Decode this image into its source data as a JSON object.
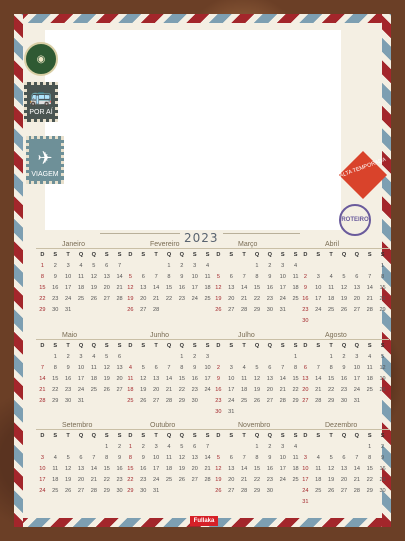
{
  "year": "2023",
  "weekday_headers": [
    "D",
    "S",
    "T",
    "Q",
    "Q",
    "S",
    "S"
  ],
  "decorations": {
    "porai_label": "POR AÍ",
    "viagem_label": "VIAGEM",
    "alta_temporada": "ALTA TEMPORADA",
    "roteiro": "ROTEIRO"
  },
  "brand": "Fullaka",
  "colors": {
    "stripe_red": "#a3262b",
    "stripe_blue": "#7d9fb2",
    "paper": "#f4efe3",
    "sunday_red": "#a3262b"
  },
  "months": [
    {
      "name": "Janeiro",
      "offset": 0,
      "days": 31
    },
    {
      "name": "Fevereiro",
      "offset": 3,
      "days": 28
    },
    {
      "name": "Março",
      "offset": 3,
      "days": 31
    },
    {
      "name": "Abril",
      "offset": 6,
      "days": 30
    },
    {
      "name": "Maio",
      "offset": 1,
      "days": 31
    },
    {
      "name": "Junho",
      "offset": 4,
      "days": 30
    },
    {
      "name": "Julho",
      "offset": 6,
      "days": 31
    },
    {
      "name": "Agosto",
      "offset": 2,
      "days": 31
    },
    {
      "name": "Setembro",
      "offset": 5,
      "days": 30
    },
    {
      "name": "Outubro",
      "offset": 0,
      "days": 31
    },
    {
      "name": "Novembro",
      "offset": 3,
      "days": 30
    },
    {
      "name": "Dezembro",
      "offset": 5,
      "days": 31
    }
  ]
}
